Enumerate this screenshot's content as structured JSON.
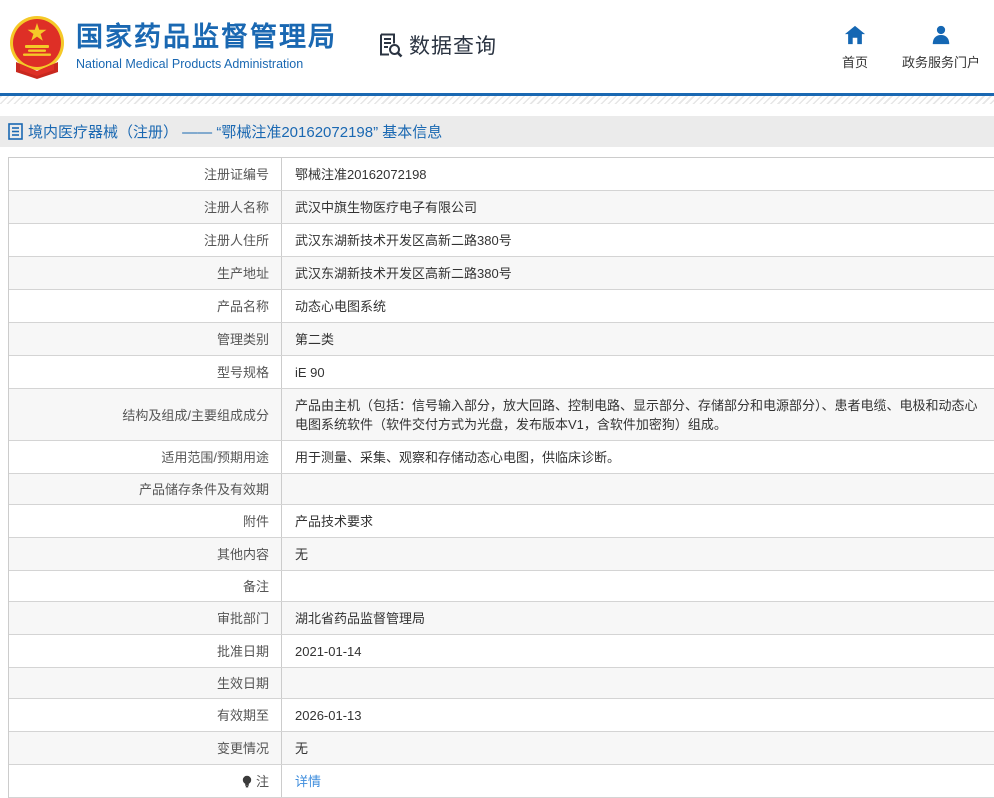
{
  "header": {
    "org_name_zh": "国家药品监督管理局",
    "org_name_en": "National Medical Products Administration",
    "section_title": "数据查询",
    "nav": [
      {
        "icon": "home-icon",
        "label": "首页"
      },
      {
        "icon": "user-icon",
        "label": "政务服务门户"
      }
    ]
  },
  "breadcrumb": {
    "text": "境内医疗器械（注册） —— “鄂械注准20162072198” 基本信息"
  },
  "table": {
    "rows": [
      {
        "label": "注册证编号",
        "value": "鄂械注准20162072198"
      },
      {
        "label": "注册人名称",
        "value": "武汉中旗生物医疗电子有限公司"
      },
      {
        "label": "注册人住所",
        "value": "武汉东湖新技术开发区高新二路380号"
      },
      {
        "label": "生产地址",
        "value": "武汉东湖新技术开发区高新二路380号"
      },
      {
        "label": "产品名称",
        "value": "动态心电图系统"
      },
      {
        "label": "管理类别",
        "value": "第二类"
      },
      {
        "label": "型号规格",
        "value": "iE 90"
      },
      {
        "label": "结构及组成/主要组成成分",
        "value": "产品由主机（包括：信号输入部分，放大回路、控制电路、显示部分、存储部分和电源部分）、患者电缆、电极和动态心电图系统软件（软件交付方式为光盘，发布版本V1，含软件加密狗）组成。"
      },
      {
        "label": "适用范围/预期用途",
        "value": "用于测量、采集、观察和存储动态心电图，供临床诊断。"
      },
      {
        "label": "产品储存条件及有效期",
        "value": ""
      },
      {
        "label": "附件",
        "value": "产品技术要求"
      },
      {
        "label": "其他内容",
        "value": "无"
      },
      {
        "label": "备注",
        "value": ""
      },
      {
        "label": "审批部门",
        "value": "湖北省药品监督管理局"
      },
      {
        "label": "批准日期",
        "value": "2021-01-14"
      },
      {
        "label": "生效日期",
        "value": ""
      },
      {
        "label": "有效期至",
        "value": "2026-01-13"
      },
      {
        "label": "变更情况",
        "value": "无"
      },
      {
        "label": "注",
        "value": "详情",
        "link": true,
        "label_icon": "bulb-note-icon"
      }
    ]
  },
  "colors": {
    "accent_blue": "#1a68b2",
    "link_blue": "#3e8ddd",
    "dark_text": "#2b3442",
    "emblem_red": "#de2f26",
    "emblem_gold": "#f5c928",
    "row_alt_bg": "#f7f7f7",
    "crumb_bg": "#ebebeb"
  }
}
